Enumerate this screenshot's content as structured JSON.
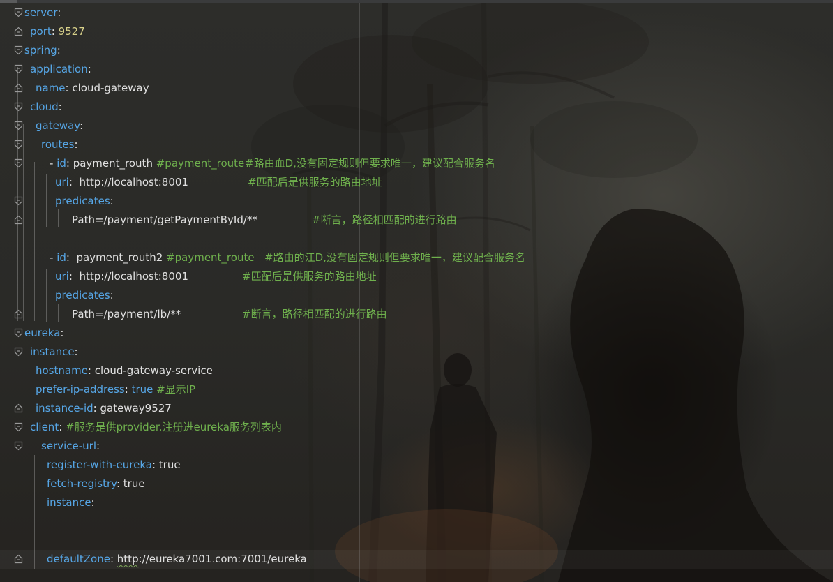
{
  "editor": {
    "lines": [
      {
        "key": "server",
        "sep": ":"
      },
      {
        "key": "port",
        "sep": ": ",
        "num": "9527"
      },
      {
        "key": "spring",
        "sep": ":"
      },
      {
        "key": "application",
        "sep": ":"
      },
      {
        "key": "name",
        "sep": ": ",
        "val": "cloud-gateway"
      },
      {
        "key": "cloud",
        "sep": ":"
      },
      {
        "key": "gateway",
        "sep": ":"
      },
      {
        "key": "routes",
        "sep": ":"
      },
      {
        "dash": "- ",
        "key": "id",
        "sep": ": ",
        "val": "payment_routh",
        "comment": "#payment_route",
        "comment2": "#路由血D,没有固定规则但要求唯一，建议配合服务名"
      },
      {
        "key": "uri",
        "sep": ":  ",
        "val": "http://localhost:8001",
        "comment": "#匹配后是供服务的路由地址"
      },
      {
        "key": "predicates",
        "sep": ":"
      },
      {
        "val": "Path=/payment/getPaymentById/**",
        "comment": "#断言，路径相匹配的进行路由"
      },
      {},
      {
        "dash": "- ",
        "key": "id",
        "sep": ":  ",
        "val": "payment_routh2",
        "comment": "#payment_route",
        "comment2": "#路由的江D,没有固定规则但要求唯一，建议配合服务名"
      },
      {
        "key": "uri",
        "sep": ":  ",
        "val": "http://localhost:8001",
        "comment": "#匹配后是供服务的路由地址"
      },
      {
        "key": "predicates",
        "sep": ":"
      },
      {
        "val": "Path=/payment/lb/**",
        "comment": "#断言，路径相匹配的进行路由"
      },
      {
        "key": "eureka",
        "sep": ":"
      },
      {
        "key": "instance",
        "sep": ":"
      },
      {
        "key": "hostname",
        "sep": ": ",
        "val": "cloud-gateway-service"
      },
      {
        "key": "prefer-ip-address",
        "sep": ": ",
        "bool": "true",
        "comment": "#显示IP"
      },
      {
        "key": "instance-id",
        "sep": ": ",
        "val": "gateway9527"
      },
      {
        "key": "client",
        "sep": ": ",
        "comment": "#服务是供provider.注册进eureka服务列表内"
      },
      {
        "key": "service-url",
        "sep": ":"
      },
      {
        "key": "register-with-eureka",
        "sep": ": ",
        "val": "true"
      },
      {
        "key": "fetch-registry",
        "sep": ": ",
        "val": "true"
      },
      {
        "key": "instance",
        "sep": ":"
      },
      {},
      {},
      {
        "key": "defaultZone",
        "sep": ": ",
        "link": "http",
        "val": "://eureka7001.com:7001/eureka"
      }
    ]
  },
  "colors": {
    "key": "#56a6e6",
    "comment": "#6fb04d",
    "number": "#d8d18a",
    "text": "#e0e0e0",
    "background": "#2a2a27"
  },
  "icons": {
    "fold_open": "fold-open-icon",
    "fold_end": "fold-end-icon"
  }
}
